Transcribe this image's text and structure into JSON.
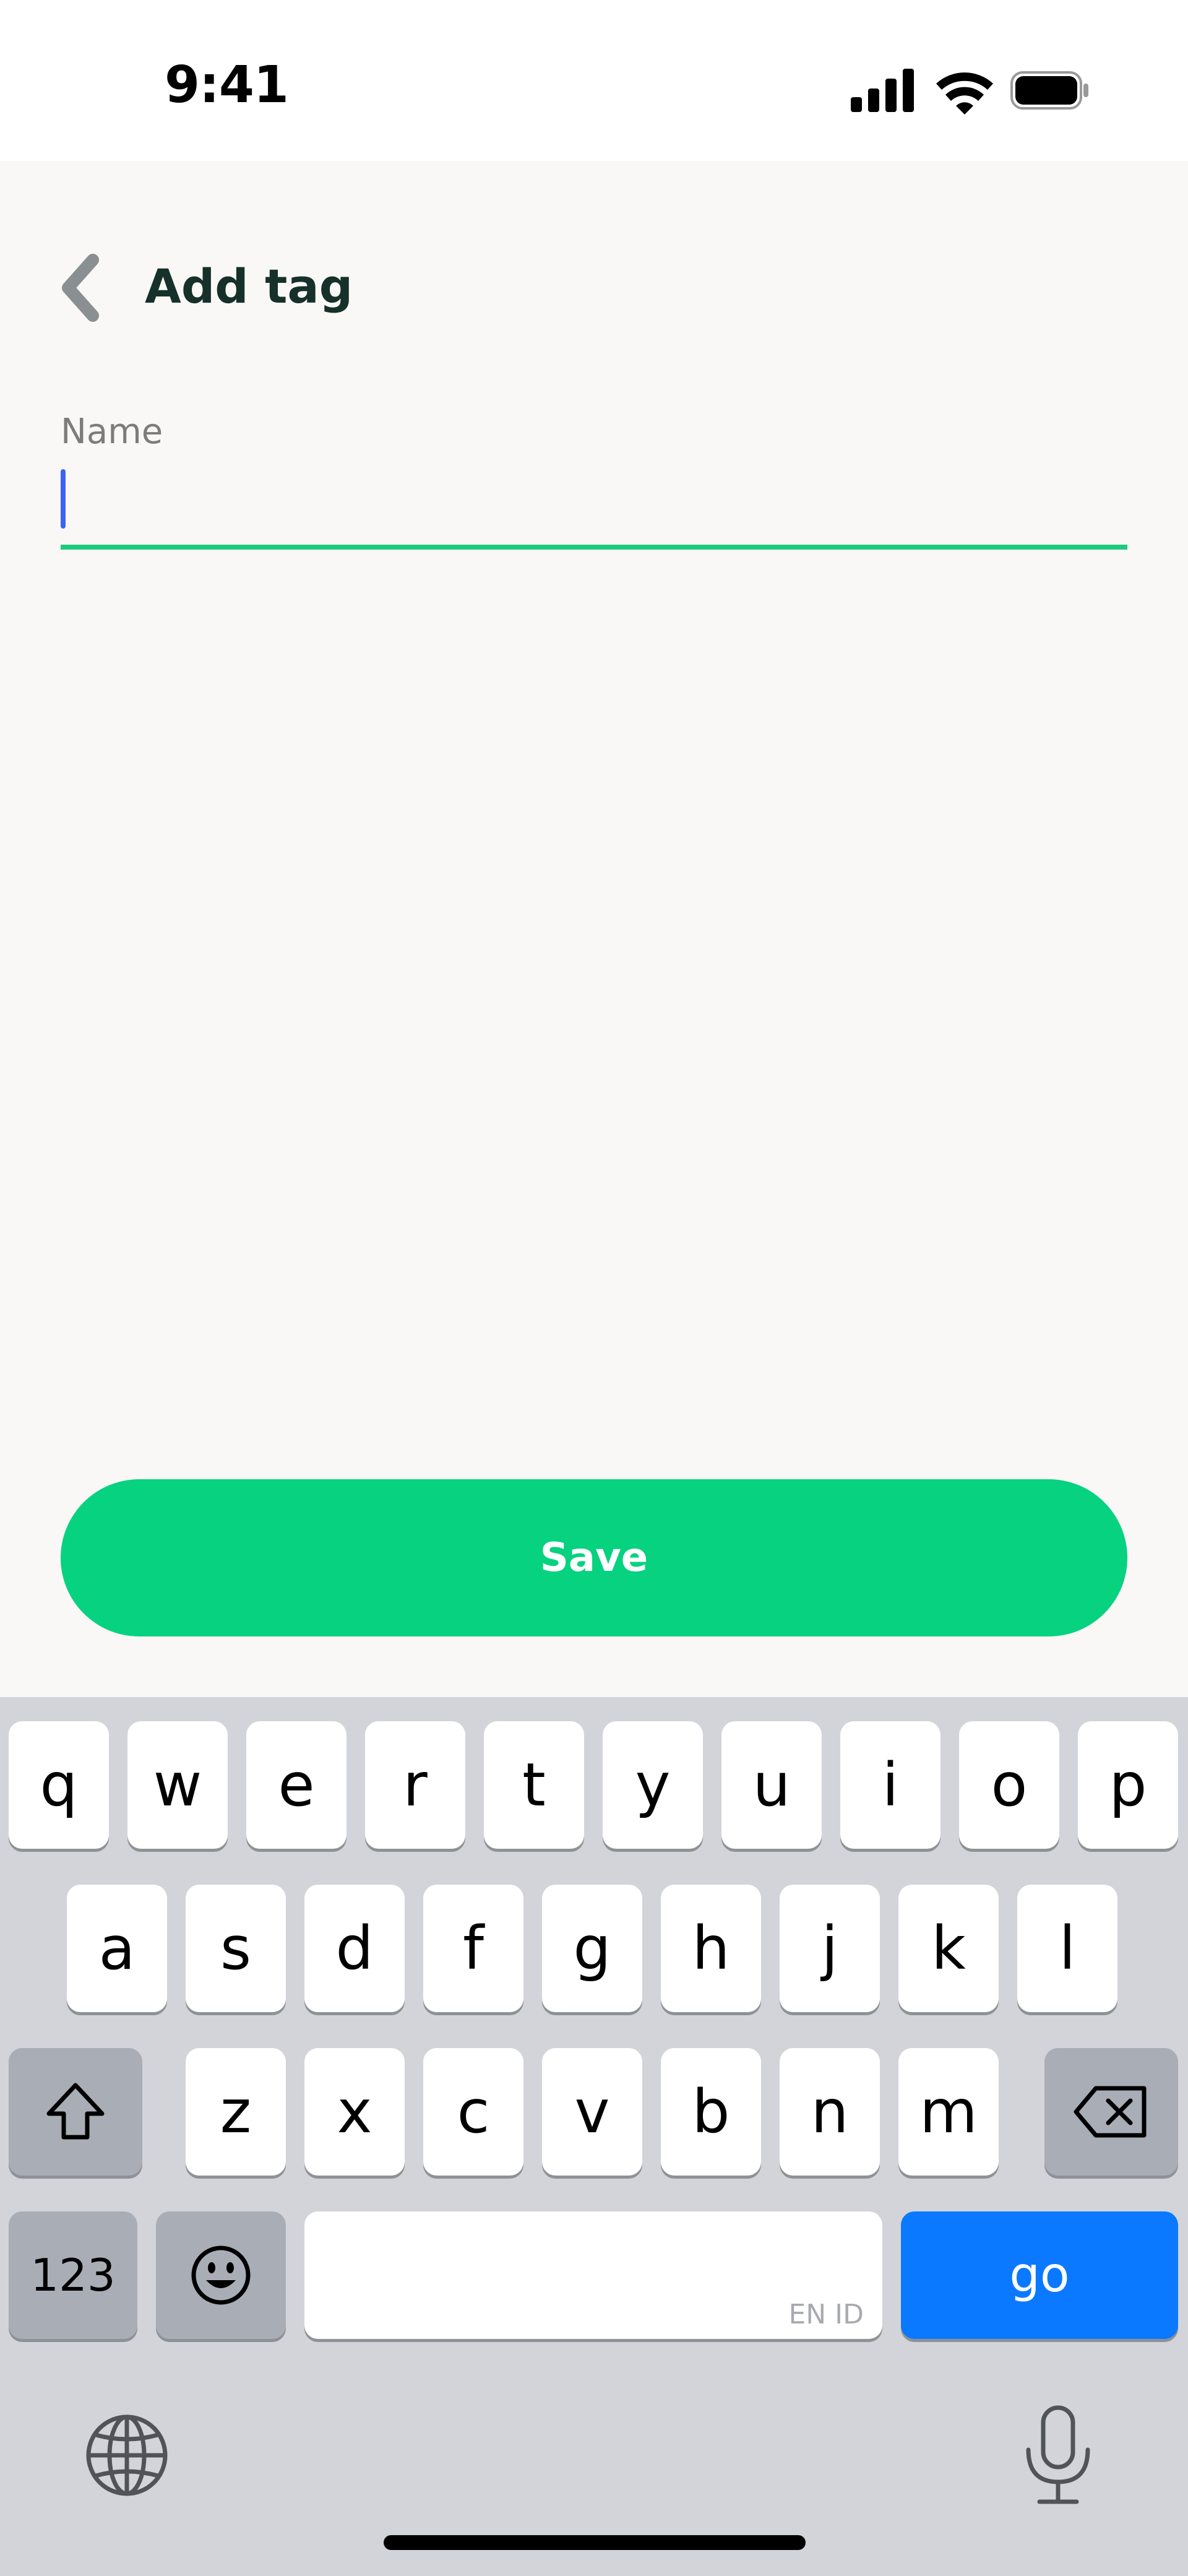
{
  "status_bar": {
    "time": "9:41"
  },
  "header": {
    "title": "Add tag"
  },
  "form": {
    "name_label": "Name",
    "name_value": ""
  },
  "actions": {
    "save_label": "Save"
  },
  "keyboard": {
    "row1": [
      "q",
      "w",
      "e",
      "r",
      "t",
      "y",
      "u",
      "i",
      "o",
      "p"
    ],
    "row2": [
      "a",
      "s",
      "d",
      "f",
      "g",
      "h",
      "j",
      "k",
      "l"
    ],
    "row3": [
      "z",
      "x",
      "c",
      "v",
      "b",
      "n",
      "m"
    ],
    "numbers_label": "123",
    "space_hint": "EN ID",
    "go_label": "go"
  },
  "icons": {
    "back": "chevron-left-icon",
    "signal": "cellular-signal-icon",
    "wifi": "wifi-icon",
    "battery": "battery-icon",
    "shift": "shift-icon",
    "delete": "backspace-icon",
    "emoji": "emoji-icon",
    "globe": "globe-icon",
    "mic": "microphone-icon"
  },
  "colors": {
    "accent": "#06D27F",
    "input_underline": "#1DCB7E",
    "caret": "#3D63F0",
    "go_key": "#0A79FF",
    "title": "#16302A"
  }
}
